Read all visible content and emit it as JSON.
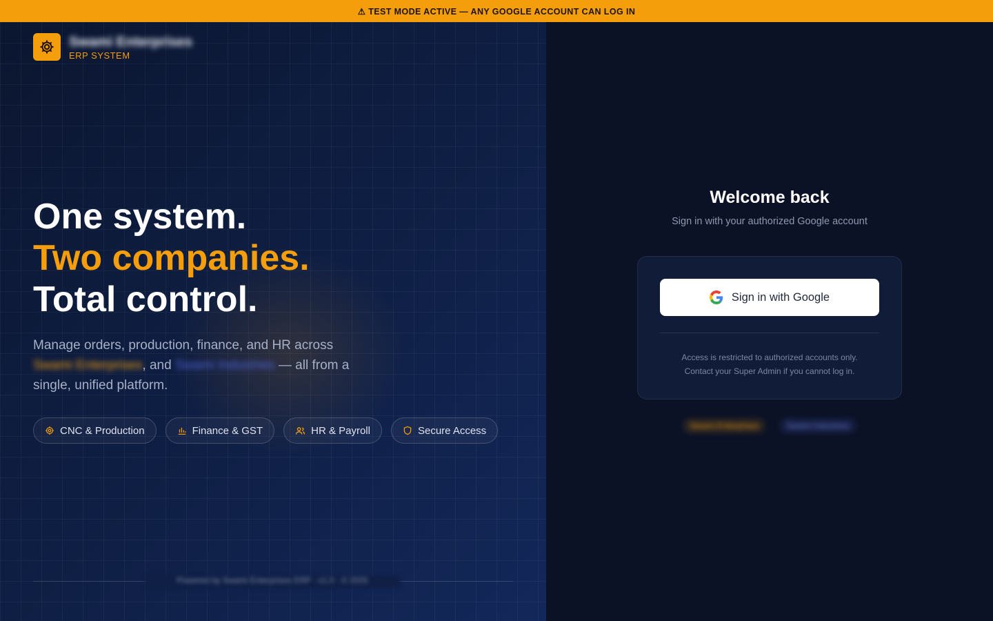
{
  "banner": {
    "icon": "warning-icon",
    "text": "⚠ TEST MODE ACTIVE — ANY GOOGLE ACCOUNT CAN LOG IN"
  },
  "brand": {
    "logo_icon": "gear-icon",
    "name": "Swami Enterprises",
    "subtitle": "ERP SYSTEM"
  },
  "hero": {
    "line1": "One system.",
    "line2": "Two companies.",
    "line3": "Total control.",
    "desc_part1": "Manage orders, production, finance, and HR across",
    "company1": "Swami Enterprises",
    "desc_part2": ", and",
    "company2": "Swami Industries",
    "desc_part3": "— all from a single, unified platform."
  },
  "features": [
    {
      "icon": "gear-icon",
      "label": "CNC & Production"
    },
    {
      "icon": "bar-chart-icon",
      "label": "Finance & GST"
    },
    {
      "icon": "users-icon",
      "label": "HR & Payroll"
    },
    {
      "icon": "shield-icon",
      "label": "Secure Access"
    }
  ],
  "footer": {
    "text": "Powered by Swami Enterprises ERP · v1.0 · © 2025"
  },
  "login": {
    "title": "Welcome back",
    "subtitle": "Sign in with your authorized Google account",
    "google_button": "Sign in with Google",
    "note_line1": "Access is restricted to authorized accounts only.",
    "note_line2": "Contact your Super Admin if you cannot log in.",
    "tag1": "Swami Enterprises",
    "tag2": "Swami Industries"
  },
  "colors": {
    "accent": "#f59e0b",
    "bg_dark": "#0b1226",
    "panel": "#101c38",
    "company2": "#4f63d9"
  }
}
